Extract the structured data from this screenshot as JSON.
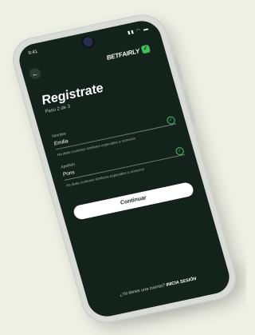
{
  "status_bar": {
    "time": "9:41",
    "icons": "▮▮ ◠ ▬"
  },
  "header": {
    "back_icon": "←",
    "logo_text": "BETFAIRLY",
    "logo_mark": "✓"
  },
  "page": {
    "title": "Registrate",
    "step": "Paso 2 de 3"
  },
  "fields": [
    {
      "label": "Nombre",
      "value": "Emilia",
      "hint": "Ha debe contener similares especiales a números",
      "valid_icon": "✓"
    },
    {
      "label": "Apellido",
      "value": "Pons",
      "hint": "Ha debe contener similares especiales a números",
      "valid_icon": "✓"
    }
  ],
  "actions": {
    "continue_label": "Continuar"
  },
  "footer": {
    "prompt": "¿Ya tienes una cuenta?",
    "link": "INICIA SESIÓN"
  },
  "colors": {
    "screen_bg": "#13221b",
    "accent": "#3fbf59",
    "button_bg": "#ffffff"
  }
}
